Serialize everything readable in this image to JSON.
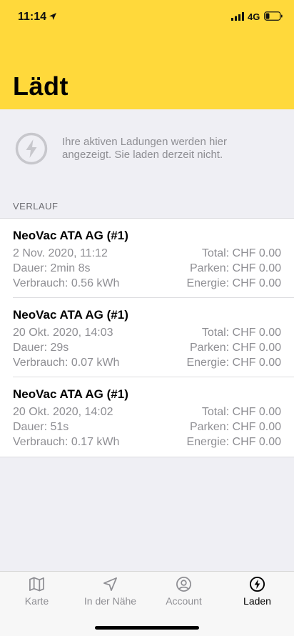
{
  "status_bar": {
    "time": "11:14",
    "network": "4G",
    "icons": [
      "location-arrow-icon",
      "signal-icon",
      "battery-icon"
    ]
  },
  "header": {
    "title": "Lädt",
    "background_color": "#ffd93b"
  },
  "info": {
    "icon": "bolt-circle-icon",
    "message": "Ihre aktiven Ladungen werden hier angezeigt. Sie laden derzeit nicht."
  },
  "history": {
    "section_label": "VERLAUF",
    "entries": [
      {
        "title": "NeoVac ATA AG (#1)",
        "date": "2 Nov. 2020, 11:12",
        "duration": "Dauer: 2min 8s",
        "consumption": "Verbrauch: 0.56 kWh",
        "total": "Total: CHF 0.00",
        "parking": "Parken: CHF 0.00",
        "energy": "Energie: CHF 0.00"
      },
      {
        "title": "NeoVac ATA AG (#1)",
        "date": "20 Okt. 2020, 14:03",
        "duration": "Dauer: 29s",
        "consumption": "Verbrauch: 0.07 kWh",
        "total": "Total: CHF 0.00",
        "parking": "Parken: CHF 0.00",
        "energy": "Energie: CHF 0.00"
      },
      {
        "title": "NeoVac ATA AG (#1)",
        "date": "20 Okt. 2020, 14:02",
        "duration": "Dauer: 51s",
        "consumption": "Verbrauch: 0.17 kWh",
        "total": "Total: CHF 0.00",
        "parking": "Parken: CHF 0.00",
        "energy": "Energie: CHF 0.00"
      }
    ]
  },
  "tab_bar": {
    "active_tab": "Laden",
    "tabs": [
      {
        "label": "Karte",
        "icon": "map-icon"
      },
      {
        "label": "In der Nähe",
        "icon": "navigation-arrow-icon"
      },
      {
        "label": "Account",
        "icon": "user-circle-icon"
      },
      {
        "label": "Laden",
        "icon": "bolt-circle-icon"
      }
    ]
  }
}
